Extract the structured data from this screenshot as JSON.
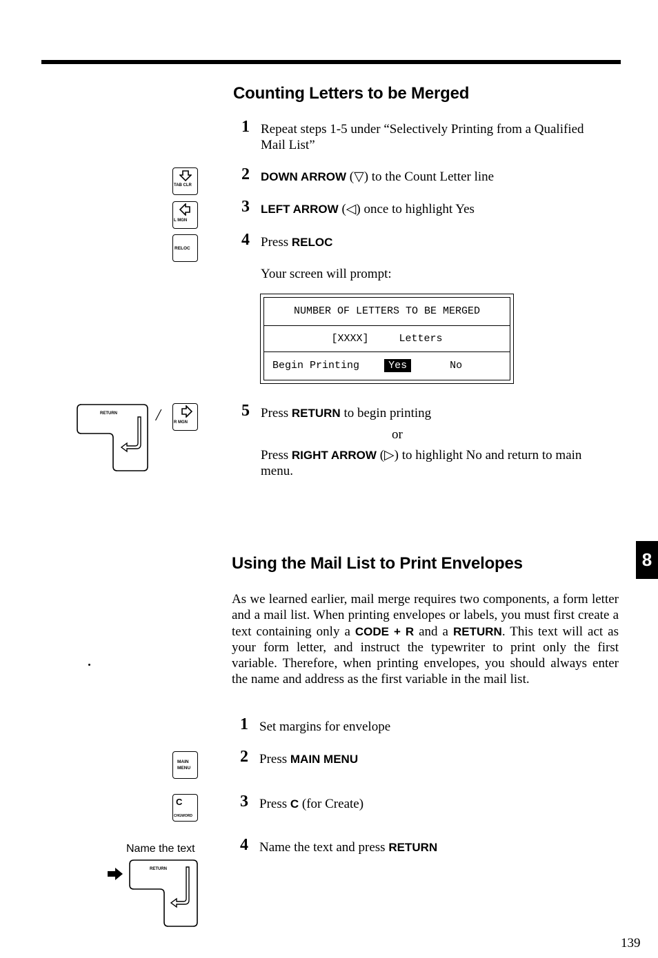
{
  "section1": {
    "title": "Counting Letters to be Merged",
    "steps": [
      {
        "num": "1",
        "text": "Repeat steps 1-5 under “Selectively Printing from a Qualified",
        "text2": "Mail List”"
      },
      {
        "num": "2",
        "bold": "DOWN ARROW",
        "pre": "",
        "post": " (▽) to the Count Letter line"
      },
      {
        "num": "3",
        "bold": "LEFT ARROW",
        "pre": "",
        "post": " (◁) once to highlight Yes"
      },
      {
        "num": "4",
        "pre": "Press ",
        "bold": "RELOC",
        "post": ""
      }
    ],
    "prompt_intro": "Your screen will prompt:",
    "screen": {
      "line1": "NUMBER OF LETTERS TO BE MERGED",
      "line2_placeholder": "[XXXX]",
      "line2_label": "Letters",
      "line3_label": "Begin Printing",
      "option_yes": "Yes",
      "option_no": "No",
      "selected": "Yes"
    },
    "step5": {
      "num": "5",
      "pre": "Press ",
      "bold": "RETURN",
      "post": " to begin printing",
      "or": "or",
      "alt_pre": "Press ",
      "alt_bold": "RIGHT ARROW",
      "alt_post": " (▷) to highlight No and return to main",
      "alt_post2": "menu."
    }
  },
  "section2": {
    "title": "Using the Mail List to Print Envelopes",
    "para": [
      {
        "t": "As we learned earlier, mail merge requires two components, a form letter and a mail list. When printing envelopes or labels, you must first create a text containing only a "
      },
      {
        "b": "CODE + R"
      },
      {
        "t": " and a "
      },
      {
        "b": "RETURN"
      },
      {
        "t": ". This text will act as your form letter, and instruct the typewriter to print only the first variable. Therefore, when printing envelopes, you should always enter the name and address as the first variable in the mail list."
      }
    ],
    "steps": [
      {
        "num": "1",
        "pre": "Set margins for envelope",
        "bold": "",
        "post": ""
      },
      {
        "num": "2",
        "pre": "Press ",
        "bold": "MAIN MENU",
        "post": ""
      },
      {
        "num": "3",
        "pre": "Press ",
        "bold": "C",
        "post": " (for Create)"
      },
      {
        "num": "4",
        "pre": "Name the text and press ",
        "bold": "RETURN",
        "post": ""
      }
    ],
    "side_label": "Name the text"
  },
  "keys": {
    "tabclr": "TAB CLR",
    "lmgn": "L MGN",
    "reloc": "RELOC",
    "return": "RETURN",
    "rmgn": "R MGN",
    "main_menu_1": "MAIN",
    "main_menu_2": "MENU",
    "c": "C",
    "chgword": "CHGWORD",
    "slash": "/"
  },
  "chapter_tab": "8",
  "page_number": "139"
}
